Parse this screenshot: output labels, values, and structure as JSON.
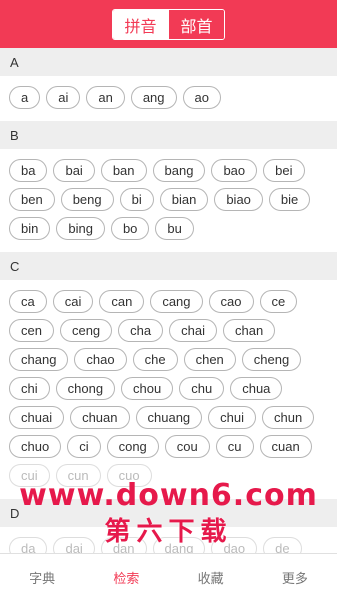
{
  "header": {
    "tab_pinyin": "拼音",
    "tab_radical": "部首"
  },
  "sections": [
    {
      "letter": "A",
      "syllables": [
        "a",
        "ai",
        "an",
        "ang",
        "ao"
      ]
    },
    {
      "letter": "B",
      "syllables": [
        "ba",
        "bai",
        "ban",
        "bang",
        "bao",
        "bei",
        "ben",
        "beng",
        "bi",
        "bian",
        "biao",
        "bie",
        "bin",
        "bing",
        "bo",
        "bu"
      ]
    },
    {
      "letter": "C",
      "syllables": [
        "ca",
        "cai",
        "can",
        "cang",
        "cao",
        "ce",
        "cen",
        "ceng",
        "cha",
        "chai",
        "chan",
        "chang",
        "chao",
        "che",
        "chen",
        "cheng",
        "chi",
        "chong",
        "chou",
        "chu",
        "chua",
        "chuai",
        "chuan",
        "chuang",
        "chui",
        "chun",
        "chuo",
        "ci",
        "cong",
        "cou",
        "cu",
        "cuan",
        "cui",
        "cun",
        "cuo"
      ]
    },
    {
      "letter": "D",
      "syllables": [
        "da",
        "dai",
        "dan",
        "dang",
        "dao",
        "de"
      ]
    }
  ],
  "watermark": {
    "url": "www.down6.com",
    "name": "第六下载"
  },
  "bottom_nav": [
    "字典",
    "检索",
    "收藏",
    "更多"
  ],
  "colors": {
    "accent": "#f23a55"
  }
}
